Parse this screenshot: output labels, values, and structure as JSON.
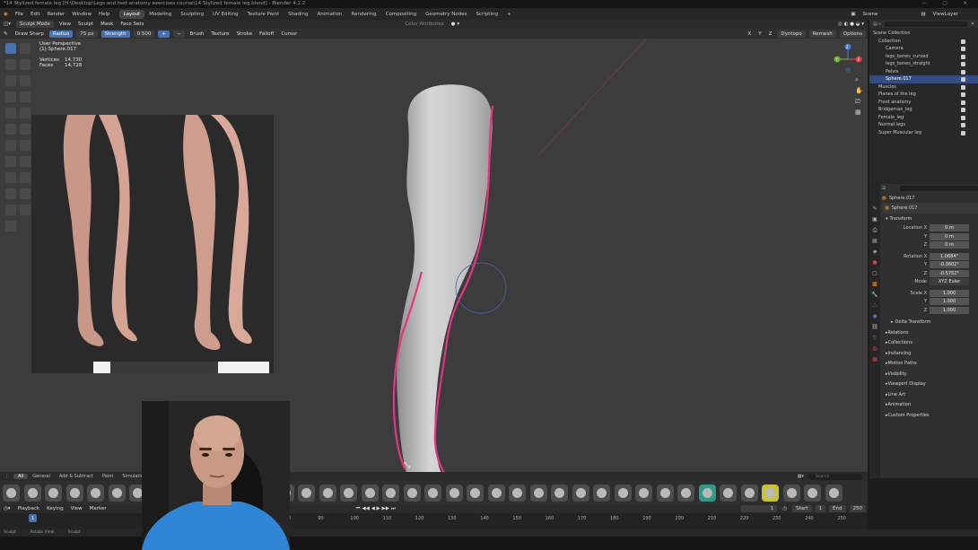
{
  "window": {
    "title": "*14 Stylized female leg [H:\\Desktop\\Legs and feet anatomy exercises course\\14 Stylized female leg.blend] - Blender 4.2.2"
  },
  "menu": {
    "items": [
      "File",
      "Edit",
      "Render",
      "Window",
      "Help"
    ],
    "workspaces": [
      "Layout",
      "Modeling",
      "Sculpting",
      "UV Editing",
      "Texture Paint",
      "Shading",
      "Animation",
      "Rendering",
      "Compositing",
      "Geometry Nodes",
      "Scripting"
    ],
    "active_workspace": "Layout",
    "add_tab": "+",
    "scene_label": "Scene",
    "view_layer_label": "ViewLayer"
  },
  "header": {
    "mode": "Sculpt Mode",
    "menus": [
      "View",
      "Sculpt",
      "Mask",
      "Face Sets"
    ],
    "color_attributes": "Color Attributes",
    "brush_name": "Draw Sharp",
    "radius_label": "Radius",
    "radius_value": "75 px",
    "strength_label": "Strength",
    "strength_value": "0.500",
    "brush_menus": [
      "Brush",
      "Texture",
      "Stroke",
      "Falloff",
      "Cursor"
    ],
    "axes": [
      "X",
      "Y",
      "Z"
    ],
    "dyntopo": "Dyntopo",
    "remesh": "Remesh",
    "options": "Options"
  },
  "viewport": {
    "perspective": "User Perspective",
    "object": "(1) Sphere.017",
    "vertices_label": "Vertices",
    "vertices_value": "14,730",
    "faces_label": "Faces",
    "faces_value": "14,728",
    "gizmo_x": "X",
    "gizmo_y": "Y",
    "gizmo_z": "Z"
  },
  "outliner": {
    "search_placeholder": "",
    "items": [
      {
        "label": "Scene Collection",
        "sel": false
      },
      {
        "label": "Collection",
        "sel": false
      },
      {
        "label": "Camera",
        "sel": false
      },
      {
        "label": "legs_bones_curved",
        "sel": false
      },
      {
        "label": "legs_bones_straight",
        "sel": false
      },
      {
        "label": "Pelvis",
        "sel": false
      },
      {
        "label": "Sphere.017",
        "sel": true
      },
      {
        "label": "Muscles",
        "sel": false
      },
      {
        "label": "Planes of the leg",
        "sel": false
      },
      {
        "label": "Front anatomy",
        "sel": false
      },
      {
        "label": "Bridgeman_leg",
        "sel": false
      },
      {
        "label": "Female_leg",
        "sel": false
      },
      {
        "label": "Normal legs",
        "sel": false
      },
      {
        "label": "Super Muscular leg",
        "sel": false
      }
    ]
  },
  "properties": {
    "object_name": "Sphere.017",
    "data_name": "Sphere.017",
    "transform_label": "Transform",
    "location_label": "Location X",
    "location": [
      "0 m",
      "0 m",
      "0 m"
    ],
    "rotation_label": "Rotation X",
    "rotation": [
      "1.0684°",
      "-0.3602°",
      "-0.5752°"
    ],
    "mode_label": "Mode",
    "mode_value": "XYZ Euler",
    "scale_label": "Scale X",
    "scale": [
      "1.000",
      "1.000",
      "1.000"
    ],
    "y_label": "Y",
    "z_label": "Z",
    "delta_transform": "Delta Transform",
    "sections": [
      "Relations",
      "Collections",
      "Instancing",
      "Motion Paths",
      "Visibility",
      "Viewport Display",
      "Line Art",
      "Animation",
      "Custom Properties"
    ]
  },
  "asset_shelf": {
    "tabs": [
      "All",
      "General",
      "Add & Subtract",
      "Paint",
      "Simulation"
    ],
    "active_tab": "All",
    "search_placeholder": "Search"
  },
  "timeline": {
    "menus": [
      "Playback",
      "Keying",
      "View",
      "Marker"
    ],
    "current_frame": "1",
    "start_label": "Start",
    "start_value": "1",
    "end_label": "End",
    "end_value": "250",
    "ticks": [
      "1",
      "80",
      "90",
      "100",
      "110",
      "120",
      "130",
      "140",
      "150",
      "160",
      "170",
      "180",
      "190",
      "200",
      "210",
      "220",
      "230",
      "240",
      "250"
    ]
  },
  "status": {
    "items": [
      "Sculpt",
      "Rotate View",
      "Sculpt"
    ]
  },
  "colors": {
    "accent": "#4772b3",
    "stroke": "#e6357f",
    "viewport_bg": "#3c3c3c",
    "panel_bg": "#303030"
  }
}
